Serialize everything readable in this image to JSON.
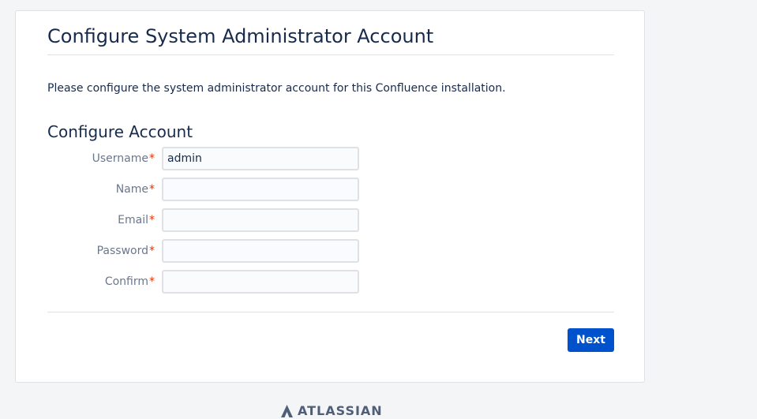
{
  "page": {
    "title": "Configure System Administrator Account",
    "intro": "Please configure the system administrator account for this Confluence installation.",
    "section_title": "Configure Account"
  },
  "form": {
    "required_marker": "*",
    "fields": [
      {
        "label": "Username",
        "value": "admin",
        "placeholder": ""
      },
      {
        "label": "Name",
        "value": "",
        "placeholder": ""
      },
      {
        "label": "Email",
        "value": "",
        "placeholder": ""
      },
      {
        "label": "Password",
        "value": "",
        "placeholder": ""
      },
      {
        "label": "Confirm",
        "value": "",
        "placeholder": ""
      }
    ]
  },
  "actions": {
    "next_label": "Next"
  },
  "footer": {
    "brand": "ATLASSIAN",
    "logo_icon": "atlassian-logo-icon"
  },
  "colors": {
    "primary": "#0052cc",
    "required": "#de350b",
    "heading": "#172b4d",
    "label": "#6b778c"
  }
}
